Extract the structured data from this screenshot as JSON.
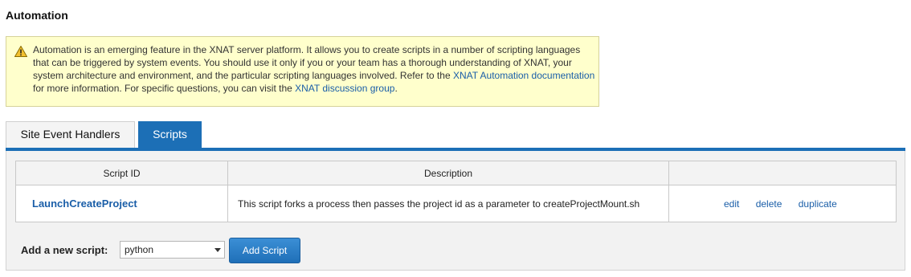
{
  "page": {
    "title": "Automation"
  },
  "warning": {
    "text_1": "Automation is an emerging feature in the XNAT server platform. It allows you to create scripts in a number of scripting languages that can be triggered by system events. You should use it only if you or your team has a thorough understanding of XNAT, your system architecture and environment, and the particular scripting languages involved. Refer to the ",
    "link_docs": "XNAT Automation documentation",
    "text_2": " for more information. For specific questions, you can visit the ",
    "link_group": "XNAT discussion group",
    "text_3": ".",
    "icon": "warning-triangle-icon",
    "colors": {
      "background": "#ffffcc",
      "link": "#1a5ea8"
    }
  },
  "tabs": [
    {
      "label": "Site Event Handlers",
      "active": false
    },
    {
      "label": "Scripts",
      "active": true
    }
  ],
  "table": {
    "headers": [
      "Script ID",
      "Description",
      ""
    ],
    "rows": [
      {
        "id": "LaunchCreateProject",
        "description": "This script forks a process then passes the project id as a parameter to createProjectMount.sh",
        "actions": [
          "edit",
          "delete",
          "duplicate"
        ]
      }
    ]
  },
  "add_script": {
    "label": "Add a new script:",
    "selected_language": "python",
    "button_label": "Add Script"
  },
  "colors": {
    "accent": "#1c6fb6"
  }
}
